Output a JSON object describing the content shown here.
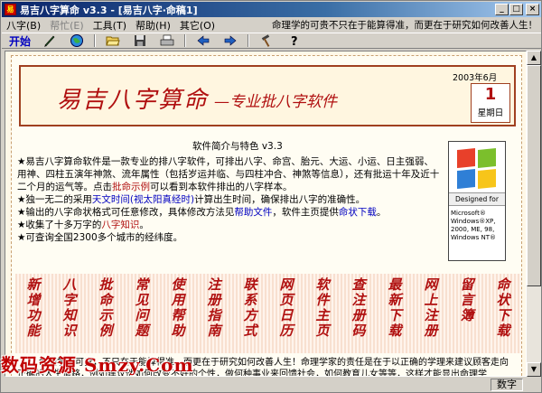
{
  "window": {
    "title": "易吉八字算命 v3.3 - [易吉八字·命稿1]",
    "app_icon": "易"
  },
  "titlebar_buttons": {
    "minimize": "_",
    "maximize": "□",
    "close": "×"
  },
  "menu": {
    "items": [
      "八字(B)",
      "帮忙(E)",
      "工具(T)",
      "帮助(H)",
      "其它(O)"
    ],
    "marquee": "命理学的可贵不只在于能算得准，而更在于研究如何改善人生！"
  },
  "toolbar": {
    "start_label": "开始",
    "icons": [
      "pencil-icon",
      "globe-icon",
      "folder-open-icon",
      "save-icon",
      "print-icon",
      "back-arrow-icon",
      "forward-arrow-icon",
      "hammer-icon",
      "help-icon"
    ]
  },
  "header": {
    "logo_title": "易吉八字算命",
    "logo_sub": "—专业批八字软件",
    "date_ym": "2003年6月",
    "date_day": "1",
    "date_weekday": "星期日"
  },
  "intro": {
    "title": "软件简介与特色 v3.3",
    "p1_a": "★易吉八字算命软件是一款专业的排八字软件，可排出八字、命宫、胎元、大运、小运、日主强弱、用神、四柱五演年神煞、流年属性（包括岁运并临、与四柱冲合、神煞等信息），还有批运十年及近十二个月的运气等。点击",
    "p1_link": "批命示例",
    "p1_b": "可以看到本软件排出的八字样本。",
    "p2_a": "★独一无二的采用",
    "p2_link1": "天文时间",
    "p2_link2": "(视太阳真经时)",
    "p2_b": "计算出生时间，确保排出八字的准确性。",
    "p3_a": "★输出的八字命状格式可任意修改，具体修改方法见",
    "p3_link1": "帮助文件",
    "p3_b": "，软件主页提供",
    "p3_link2": "命状下载",
    "p3_c": "。",
    "p4_a": "★收集了十多万字的",
    "p4_link": "八字知识",
    "p4_b": "。",
    "p5": "★可查询全国2300多个城市的经纬度。"
  },
  "win_logo": {
    "designed": "Designed for",
    "os1": "Microsoft®",
    "os2": "Windows®XP,",
    "os3": "2000, ME, 98,",
    "os4": "Windows NT®",
    "colors": [
      "#e8402a",
      "#7bbf2c",
      "#2f7fd6",
      "#f7c51a"
    ]
  },
  "banners": [
    "新增功能",
    "八字知识",
    "批命示例",
    "常见问题",
    "使用帮助",
    "注册指南",
    "联系方式",
    "网页日历",
    "软件主页",
    "查注册码",
    "最新下载",
    "网上注册",
    "留言簿",
    "命状下载"
  ],
  "bottom_text": "命理学的可贵，不只在于能算得准，而更在于研究如何改善人生！命理学家的责任是在于以正确的学理来建议顾客走向正确的人生道路，例如建议他如何改变不好的个性，做何种事业来回馈社会，如何教育儿女等等，这样才能显出命理学",
  "status": {
    "cell": "数字"
  },
  "watermark": "数码资源 Smzy.Com"
}
